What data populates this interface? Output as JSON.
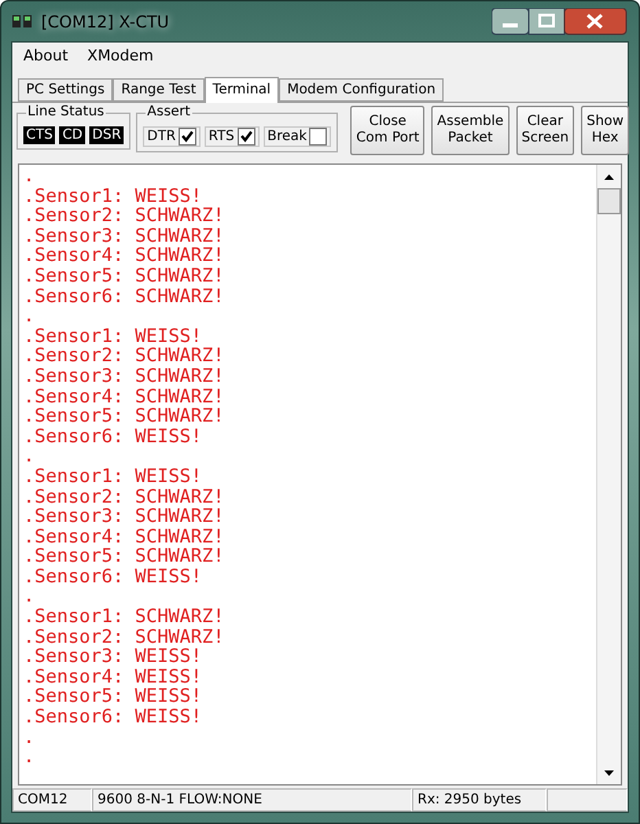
{
  "window": {
    "title": "[COM12] X-CTU"
  },
  "menu": [
    "About",
    "XModem"
  ],
  "tabs": [
    {
      "label": "PC Settings",
      "selected": false
    },
    {
      "label": "Range Test",
      "selected": false
    },
    {
      "label": "Terminal",
      "selected": true
    },
    {
      "label": "Modem Configuration",
      "selected": false
    }
  ],
  "line_status": {
    "title": "Line Status",
    "signals": [
      {
        "label": "CTS",
        "on": true
      },
      {
        "label": "CD",
        "on": true
      },
      {
        "label": "DSR",
        "on": true
      }
    ]
  },
  "assert": {
    "title": "Assert",
    "options": [
      {
        "label": "DTR",
        "checked": true
      },
      {
        "label": "RTS",
        "checked": true
      },
      {
        "label": "Break",
        "checked": false
      }
    ]
  },
  "buttons": [
    [
      "Close",
      "Com Port"
    ],
    [
      "Assemble",
      "Packet"
    ],
    [
      "Clear",
      "Screen"
    ],
    [
      "Show",
      "Hex"
    ]
  ],
  "terminal_lines": [
    ".",
    ".Sensor1: WEISS!",
    ".Sensor2: SCHWARZ!",
    ".Sensor3: SCHWARZ!",
    ".Sensor4: SCHWARZ!",
    ".Sensor5: SCHWARZ!",
    ".Sensor6: SCHWARZ!",
    ".",
    ".Sensor1: WEISS!",
    ".Sensor2: SCHWARZ!",
    ".Sensor3: SCHWARZ!",
    ".Sensor4: SCHWARZ!",
    ".Sensor5: SCHWARZ!",
    ".Sensor6: WEISS!",
    ".",
    ".Sensor1: WEISS!",
    ".Sensor2: SCHWARZ!",
    ".Sensor3: SCHWARZ!",
    ".Sensor4: SCHWARZ!",
    ".Sensor5: SCHWARZ!",
    ".Sensor6: WEISS!",
    ".",
    ".Sensor1: SCHWARZ!",
    ".Sensor2: SCHWARZ!",
    ".Sensor3: WEISS!",
    ".Sensor4: WEISS!",
    ".Sensor5: WEISS!",
    ".Sensor6: WEISS!",
    ".",
    "."
  ],
  "status_bar": [
    "COM12",
    "9600 8-N-1  FLOW:NONE",
    "Rx: 2950 bytes"
  ]
}
